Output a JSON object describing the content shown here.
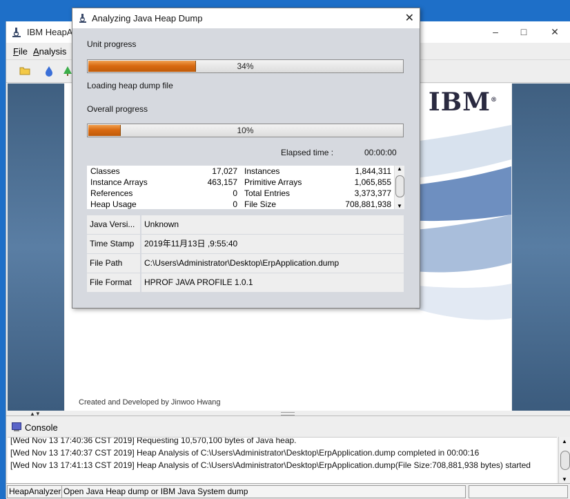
{
  "main_window": {
    "title": "IBM HeapA",
    "menu": [
      {
        "label": "File",
        "mnemonic": "F",
        "rest": "ile"
      },
      {
        "label": "Analysis",
        "mnemonic": "A",
        "rest": "nalysis"
      }
    ],
    "toolbar_icons": [
      "folder-open-icon",
      "drop-icon",
      "tree-icon"
    ],
    "splash": {
      "logo": "IBM",
      "credit": "Created and Developed by Jinwoo Hwang"
    },
    "console": {
      "title": "Console",
      "lines": [
        "[Wed Nov 13 17:40:36 CST 2019] Requesting 10,570,100 bytes of Java heap.",
        "[Wed Nov 13 17:40:37 CST 2019] Heap Analysis of C:\\Users\\Administrator\\Desktop\\ErpApplication.dump completed in 00:00:16",
        "[Wed Nov 13 17:41:13 CST 2019] Heap Analysis of C:\\Users\\Administrator\\Desktop\\ErpApplication.dump(File Size:708,881,938 bytes) started"
      ]
    },
    "status": {
      "app_name": "HeapAnalyzer",
      "message": "Open Java Heap dump or IBM Java System dump",
      "extra": ""
    }
  },
  "dialog": {
    "title": "Analyzing Java Heap Dump",
    "unit_progress": {
      "label": "Unit progress",
      "value": 0.34,
      "text": "34%"
    },
    "loading_text": "Loading heap dump file",
    "overall_progress": {
      "label": "Overall progress",
      "value": 0.1,
      "text": "10%"
    },
    "elapsed": {
      "label": "Elapsed time :",
      "value": "00:00:00"
    },
    "stats": [
      {
        "label": "Classes",
        "value": "17,027",
        "label2": "Instances",
        "value2": "1,844,311"
      },
      {
        "label": "Instance Arrays",
        "value": "463,157",
        "label2": "Primitive Arrays",
        "value2": "1,065,855"
      },
      {
        "label": "References",
        "value": "0",
        "label2": "Total Entries",
        "value2": "3,373,377"
      },
      {
        "label": "Heap Usage",
        "value": "0",
        "label2": "File Size",
        "value2": "708,881,938"
      }
    ],
    "info": [
      {
        "key": "Java Versi...",
        "value": "Unknown"
      },
      {
        "key": "Time Stamp",
        "value": "2019年11月13日 ,9:55:40"
      },
      {
        "key": "File Path",
        "value": "C:\\Users\\Administrator\\Desktop\\ErpApplication.dump"
      },
      {
        "key": "File Format",
        "value": "HPROF JAVA PROFILE 1.0.1"
      }
    ]
  }
}
